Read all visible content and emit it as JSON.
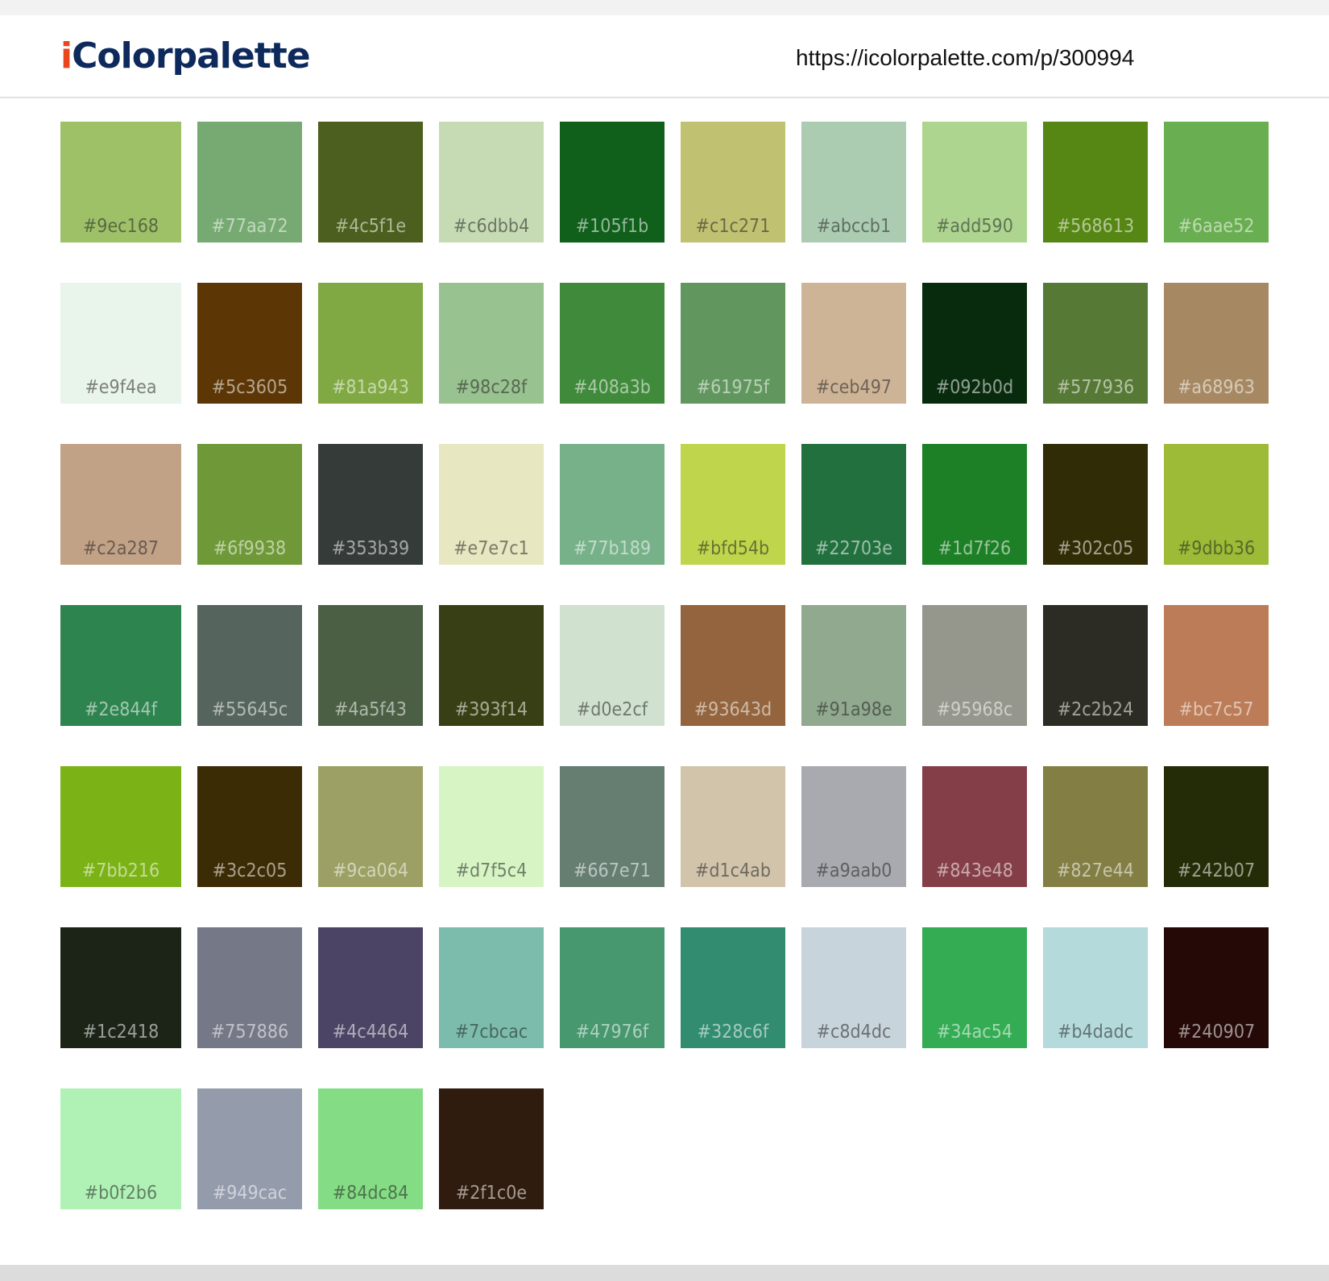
{
  "header": {
    "logo_i": "i",
    "logo_rest": "Colorpalette",
    "url": "https://icolorpalette.com/p/300994"
  },
  "colors": {
    "logo_i": "#e8461e",
    "logo_rest": "#0e2a5c",
    "background": "#f2f2f2",
    "sheet": "#ffffff"
  },
  "palette": [
    "#9ec168",
    "#77aa72",
    "#4c5f1e",
    "#c6dbb4",
    "#105f1b",
    "#c1c271",
    "#abccb1",
    "#add590",
    "#568613",
    "#6aae52",
    "#e9f4ea",
    "#5c3605",
    "#81a943",
    "#98c28f",
    "#408a3b",
    "#61975f",
    "#ceb497",
    "#092b0d",
    "#577936",
    "#a68963",
    "#c2a287",
    "#6f9938",
    "#353b39",
    "#e7e7c1",
    "#77b189",
    "#bfd54b",
    "#22703e",
    "#1d7f26",
    "#302c05",
    "#9dbb36",
    "#2e844f",
    "#55645c",
    "#4a5f43",
    "#393f14",
    "#d0e2cf",
    "#93643d",
    "#91a98e",
    "#95968c",
    "#2c2b24",
    "#bc7c57",
    "#7bb216",
    "#3c2c05",
    "#9ca064",
    "#d7f5c4",
    "#667e71",
    "#d1c4ab",
    "#a9aab0",
    "#843e48",
    "#827e44",
    "#242b07",
    "#1c2418",
    "#757886",
    "#4c4464",
    "#7cbcac",
    "#47976f",
    "#328c6f",
    "#c8d4dc",
    "#34ac54",
    "#b4dadc",
    "#240907",
    "#b0f2b6",
    "#949cac",
    "#84dc84",
    "#2f1c0e"
  ]
}
